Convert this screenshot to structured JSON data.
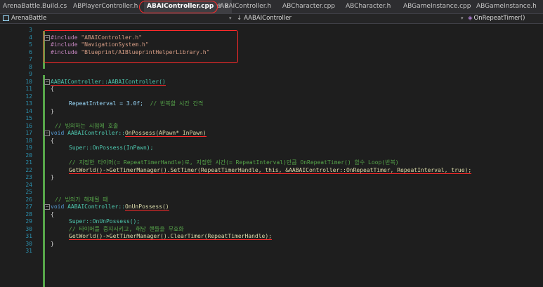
{
  "tabs": [
    {
      "label": "ArenaBattle.Build.cs",
      "active": false
    },
    {
      "label": "ABPlayerController.h",
      "active": false
    },
    {
      "label": "ABAIController.cpp",
      "active": true
    },
    {
      "label": "ABAIController.h",
      "active": false
    },
    {
      "label": "ABCharacter.cpp",
      "active": false
    },
    {
      "label": "ABCharacter.h",
      "active": false
    },
    {
      "label": "ABGameInstance.cpp",
      "active": false
    },
    {
      "label": "ABGameInstance.h",
      "active": false
    }
  ],
  "navbar": {
    "project": "ArenaBattle",
    "scope": "AABAIController",
    "member": "OnRepeatTimer()"
  },
  "code": {
    "line_numbers": [
      "3",
      "4",
      "5",
      "6",
      "7",
      "8",
      "9",
      "10",
      "11",
      "12",
      "13",
      "14",
      "15",
      "16",
      "17",
      "18",
      "19",
      "20",
      "21",
      "22",
      "23",
      "24",
      "25",
      "26",
      "27",
      "28",
      "29",
      "30",
      "31"
    ],
    "include1_dir": "#include",
    "include1_file": "\"ABAIController.h\"",
    "include2_dir": "#include",
    "include2_file": "\"NavigationSystem.h\"",
    "include3_dir": "#include",
    "include3_file": "\"Blueprint/AIBlueprintHelperLibrary.h\"",
    "ctor_def": "AABAIController::AABAIController()",
    "brace_open": "{",
    "brace_close": "}",
    "repeat_assign": "RepeatInterval = 3.0f;",
    "repeat_comment": "// 반복할 시간 간격",
    "comment_possess": "// 빙의하는 시점에 호출",
    "possess_void": "void",
    "possess_class": "AABAIController::",
    "possess_func": "OnPossess(APawn* InPawn)",
    "super_possess": "Super::OnPossess(InPawn);",
    "timer_comment": "// 지정한 타이머(= RepeatTimerHandle)로, 지정한 시간(= RepeatInterval)만큼 OnRepeatTimer() 함수 Loop(반복)",
    "settimer_call": "GetWorld()->GetTimerManager().SetTimer(RepeatTimerHandle, this, &AABAIController::OnRepeatTimer, RepeatInterval, true);",
    "comment_unpossess": "// 빙의가 해제될 때",
    "unpossess_void": "void",
    "unpossess_class": "AABAIController::",
    "unpossess_func": "OnUnPossess()",
    "super_unpossess": "Super::OnUnPossess();",
    "stop_comment": "// 타이머를 중지시키고, 해당 핸들을 무효화",
    "cleartimer_call": "GetWorld()->GetTimerManager().ClearTimer(RepeatTimerHandle);"
  }
}
